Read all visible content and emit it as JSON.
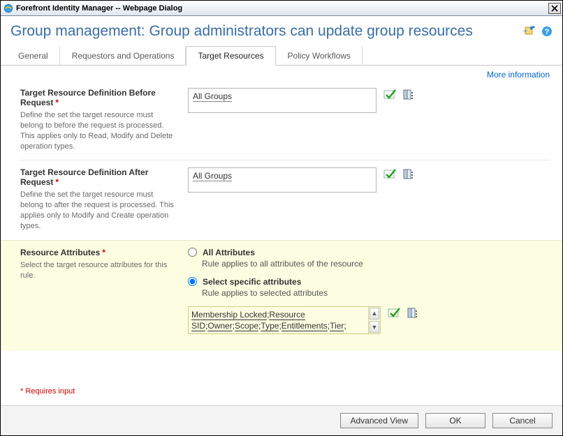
{
  "window": {
    "title": "Forefront Identity Manager -- Webpage Dialog"
  },
  "page": {
    "title": "Group management: Group administrators can update group resources"
  },
  "tabs": {
    "items": [
      "General",
      "Requestors and Operations",
      "Target Resources",
      "Policy Workflows"
    ],
    "active_index": 2
  },
  "links": {
    "more_info": "More information"
  },
  "sections": {
    "before": {
      "label": "Target Resource Definition Before Request",
      "desc": "Define the set the target resource must belong to before the request is processed. This applies only to Read, Modify and Delete operation types.",
      "value": "All Groups"
    },
    "after": {
      "label": "Target Resource Definition After Request",
      "desc": "Define the set the target resource must belong to after the request is processed. This applies only to Modify and Create operation types.",
      "value": "All Groups"
    },
    "attrs": {
      "label": "Resource Attributes",
      "desc": "Select the target resource attributes for this rule.",
      "option_all": {
        "label": "All Attributes",
        "sub": "Rule applies to all attributes of the resource"
      },
      "option_sel": {
        "label": "Select specific attributes",
        "sub": "Rule applies to selected attributes"
      },
      "selected_attributes": [
        "Membership Locked",
        "Resource SID",
        "Owner",
        "Scope",
        "Type",
        "Entitlements",
        "Tier"
      ]
    }
  },
  "footnote": "* Requires input",
  "buttons": {
    "advanced": "Advanced View",
    "ok": "OK",
    "cancel": "Cancel"
  },
  "icons": {
    "check": "validate-icon",
    "browse": "browse-icon",
    "pin": "pin-icon",
    "help": "help-icon"
  }
}
